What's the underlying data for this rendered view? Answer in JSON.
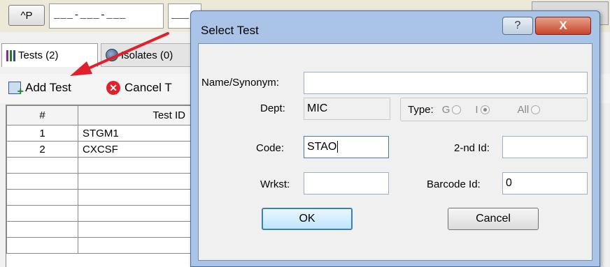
{
  "app": {
    "ctrl_p_label": "^P",
    "date_mask": "___-___-___",
    "time_mask": "___-",
    "tabs": [
      {
        "label": "Tests (2)"
      },
      {
        "label": "Isolates (0)"
      }
    ],
    "toolbar": {
      "add_test_label": "Add Test",
      "cancel_label": "Cancel T"
    },
    "grid": {
      "columns": [
        "#",
        "Test ID"
      ],
      "rows": [
        [
          "1",
          "STGM1"
        ],
        [
          "2",
          "CXCSF"
        ],
        [
          "",
          ""
        ],
        [
          "",
          ""
        ],
        [
          "",
          ""
        ],
        [
          "",
          ""
        ],
        [
          "",
          ""
        ],
        [
          "",
          ""
        ]
      ]
    }
  },
  "dialog": {
    "title": "Select Test",
    "help_label": "?",
    "close_label": "X",
    "name_label": "Name/Synonym:",
    "name_value": "",
    "dept_label": "Dept:",
    "dept_value": "MIC",
    "type_label": "Type:",
    "type_options": [
      {
        "label": "G",
        "selected": false
      },
      {
        "label": "I",
        "selected": true
      },
      {
        "label": "All",
        "selected": false
      }
    ],
    "code_label": "Code:",
    "code_value": "STAO",
    "second_id_label": "2-nd Id:",
    "second_id_value": "",
    "wrkst_label": "Wrkst:",
    "wrkst_value": "",
    "barcode_label": "Barcode Id:",
    "barcode_value": "0",
    "ok_label": "OK",
    "cancel_label": "Cancel"
  },
  "colors": {
    "arrow": "#e0202a",
    "dialog_frame": "#aac4e8",
    "close_button": "#c8452c"
  }
}
